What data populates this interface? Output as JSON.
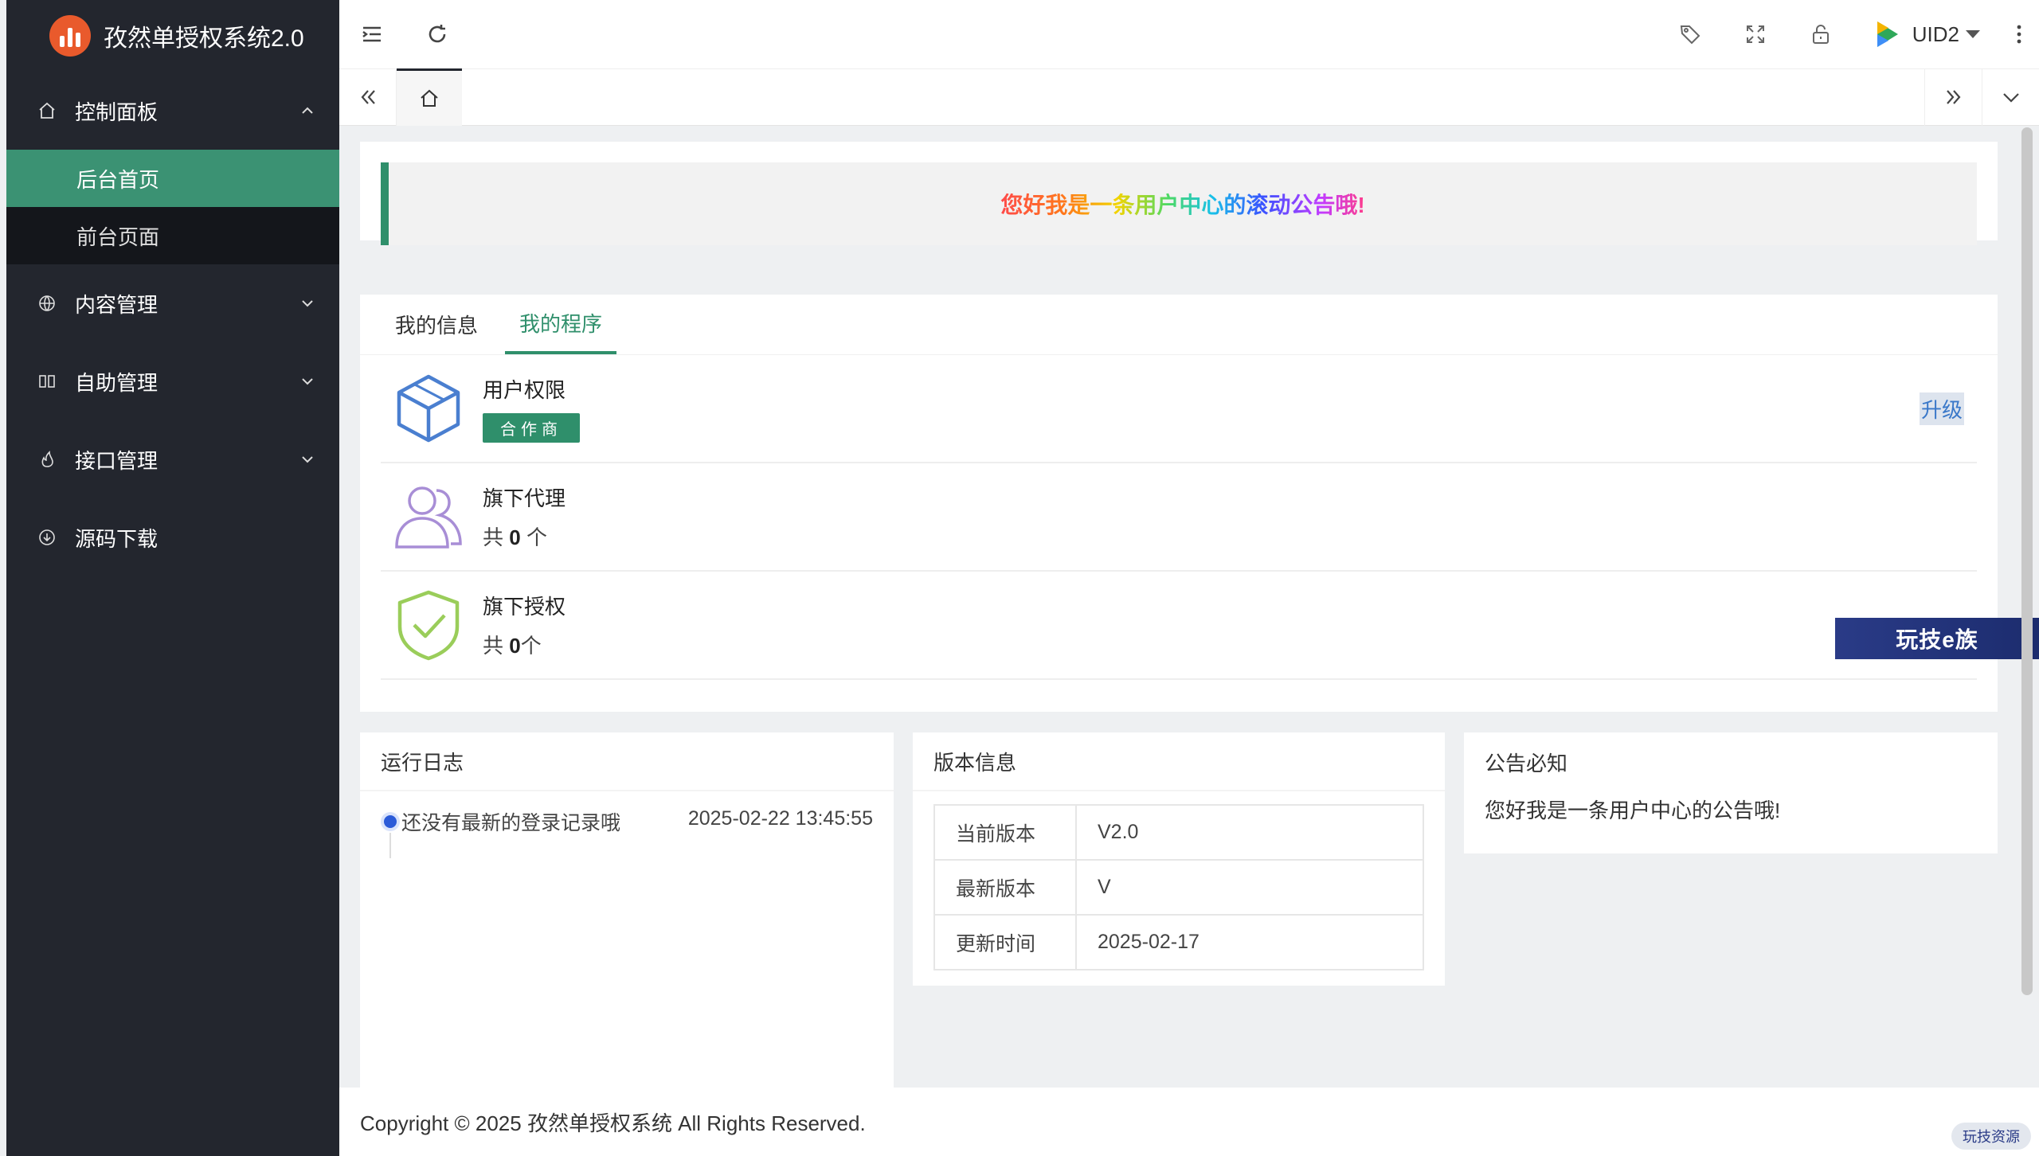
{
  "app": {
    "title": "孜然单授权系统2.0"
  },
  "sidebar": {
    "groups": [
      {
        "label": "控制面板",
        "icon": "home-icon",
        "expanded": true,
        "items": [
          {
            "label": "后台首页",
            "active": true
          },
          {
            "label": "前台页面",
            "active": false
          }
        ]
      },
      {
        "label": "内容管理",
        "icon": "globe-icon",
        "expanded": false
      },
      {
        "label": "自助管理",
        "icon": "columns-icon",
        "expanded": false
      },
      {
        "label": "接口管理",
        "icon": "fire-icon",
        "expanded": false
      },
      {
        "label": "源码下载",
        "icon": "download-icon"
      }
    ]
  },
  "header": {
    "user_name": "UID2"
  },
  "notice": {
    "text": "您好我是一条用户中心的滚动公告哦!"
  },
  "program": {
    "tabs": [
      {
        "label": "我的信息",
        "active": false
      },
      {
        "label": "我的程序",
        "active": true
      }
    ],
    "rows": [
      {
        "title": "用户权限",
        "badge": "合作商",
        "action": "升级",
        "icon": "cube-icon"
      },
      {
        "title": "旗下代理",
        "prefix": "共",
        "count": "0",
        "suffix": "个",
        "icon": "users-icon"
      },
      {
        "title": "旗下授权",
        "prefix": "共",
        "count": "0",
        "suffix": "个",
        "icon": "shield-check-icon"
      }
    ],
    "stamp": "玩技e族"
  },
  "log": {
    "title": "运行日志",
    "items": [
      {
        "text": "还没有最新的登录记录哦",
        "time": "2025-02-22 13:45:55"
      }
    ]
  },
  "version": {
    "title": "版本信息",
    "rows": [
      {
        "key": "当前版本",
        "value": "V2.0"
      },
      {
        "key": "最新版本",
        "value": "V"
      },
      {
        "key": "更新时间",
        "value": "2025-02-17"
      }
    ]
  },
  "announcement": {
    "title": "公告必知",
    "text": "您好我是一条用户中心的公告哦!"
  },
  "footer": {
    "copyright": "Copyright © 2025 孜然单授权系统 All Rights Reserved.",
    "watermark": "玩技资源"
  },
  "colors": {
    "accent": "#2f8f6b",
    "sidebar_bg": "#23262e",
    "active_item": "#3b9273",
    "link": "#3a78c9"
  }
}
